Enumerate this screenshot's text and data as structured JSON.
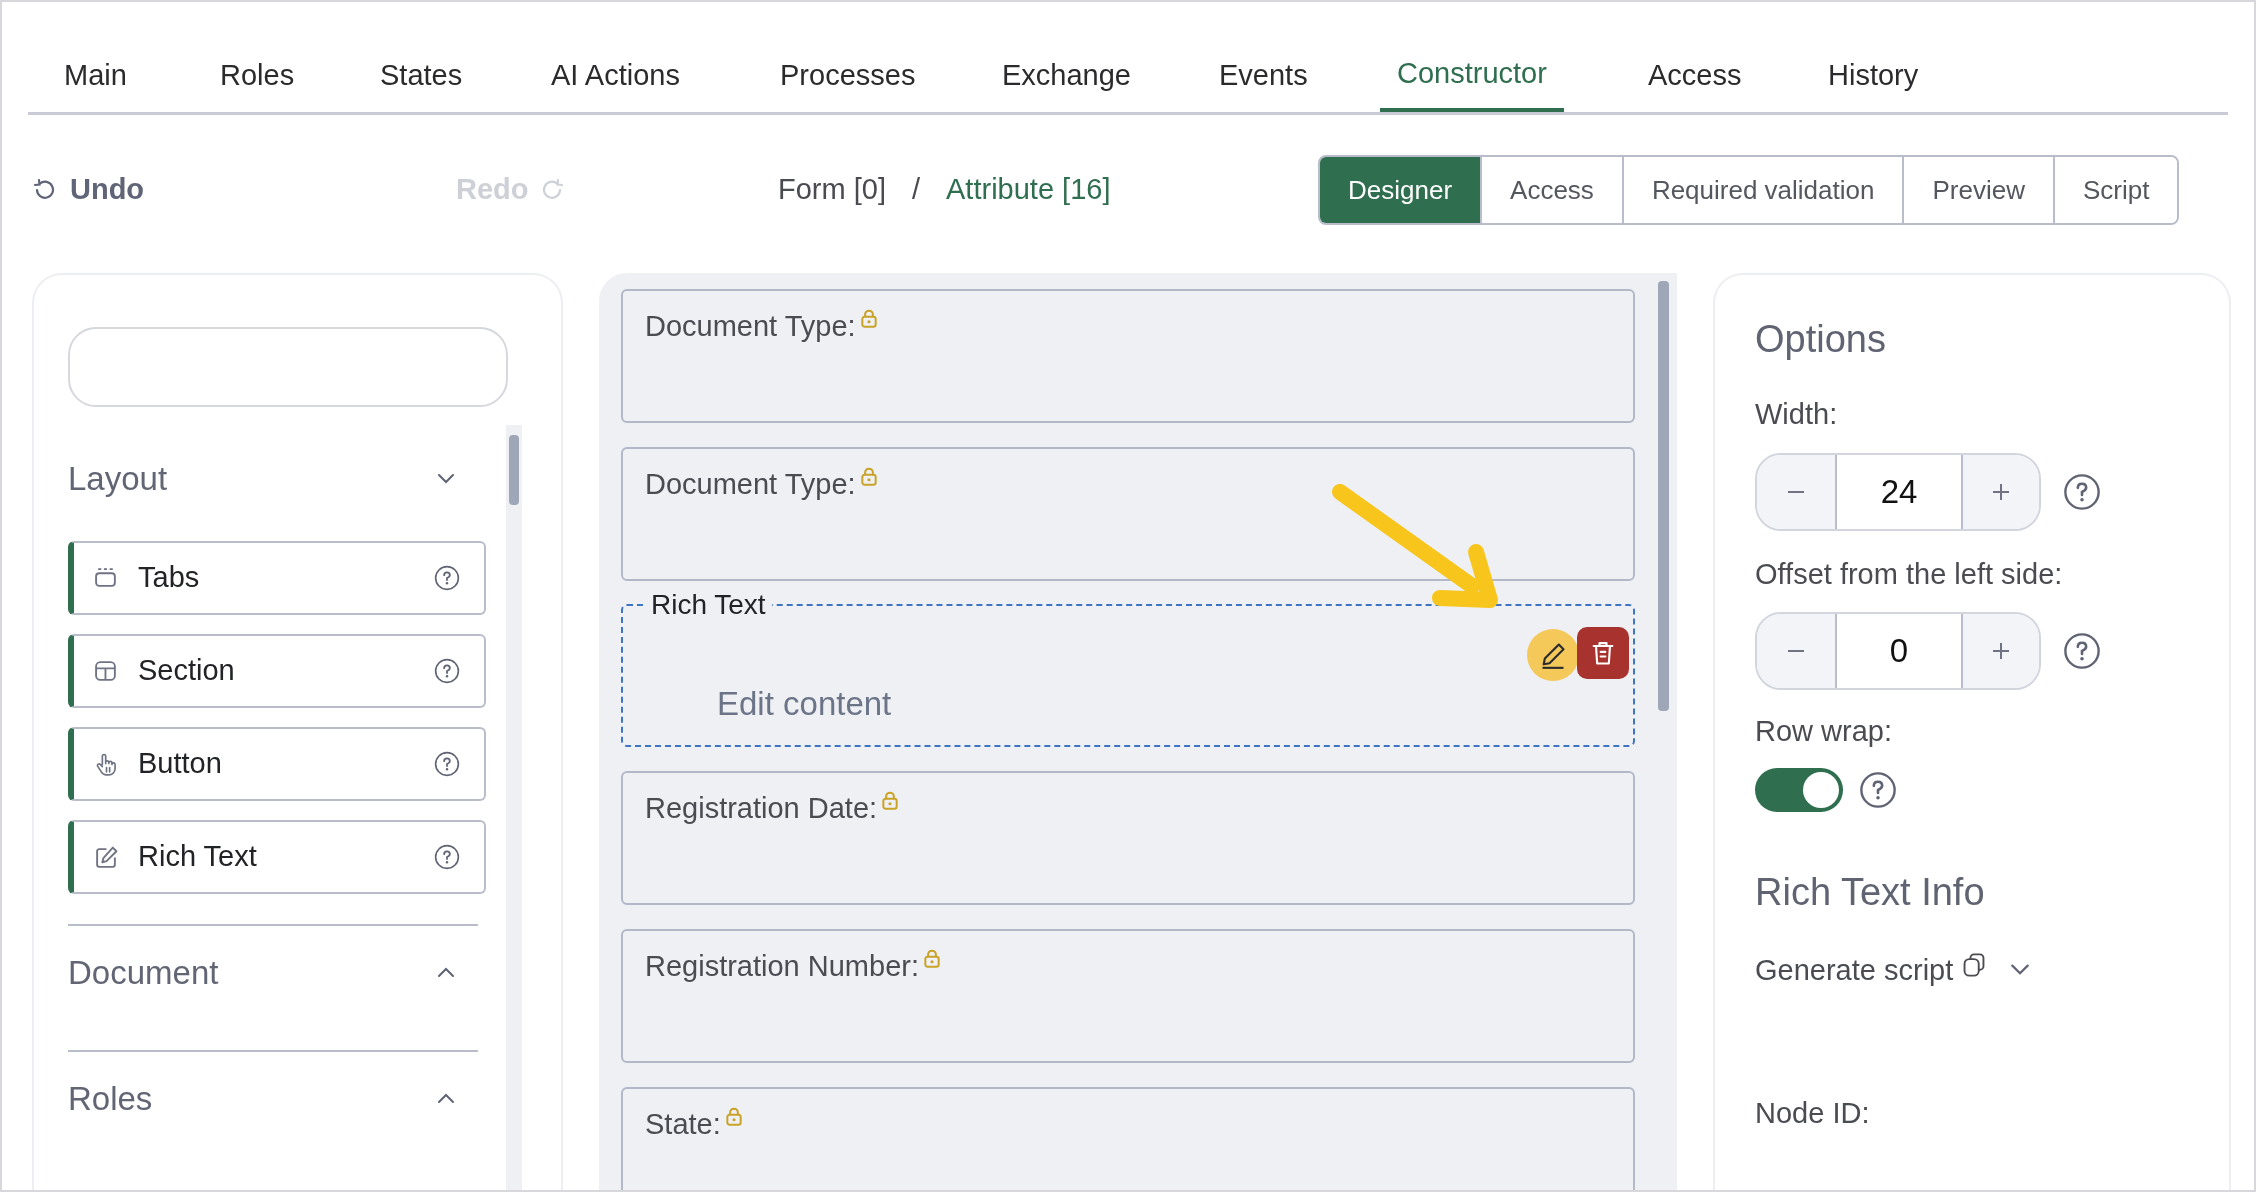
{
  "tabs": [
    {
      "label": "Main",
      "selected": false
    },
    {
      "label": "Roles",
      "selected": false
    },
    {
      "label": "States",
      "selected": false
    },
    {
      "label": "AI Actions",
      "selected": false
    },
    {
      "label": "Processes",
      "selected": false
    },
    {
      "label": "Exchange",
      "selected": false
    },
    {
      "label": "Events",
      "selected": false
    },
    {
      "label": "Constructor",
      "selected": true
    },
    {
      "label": "Access",
      "selected": false
    },
    {
      "label": "History",
      "selected": false
    }
  ],
  "toolbar": {
    "undo": {
      "label": "Undo",
      "disabled": false
    },
    "redo": {
      "label": "Redo",
      "disabled": true
    },
    "breadcrumb": [
      {
        "label": "Form [0]",
        "current": false
      },
      {
        "label": "Attribute [16]",
        "current": true
      }
    ],
    "separator": "/",
    "modes": [
      {
        "label": "Designer",
        "selected": true
      },
      {
        "label": "Access",
        "selected": false
      },
      {
        "label": "Required validation",
        "selected": false
      },
      {
        "label": "Preview",
        "selected": false
      },
      {
        "label": "Script",
        "selected": false
      }
    ]
  },
  "palette": {
    "sections": [
      {
        "title": "Layout",
        "expanded": true,
        "items": [
          {
            "label": "Tabs",
            "kind": "tabs"
          },
          {
            "label": "Section",
            "kind": "section"
          },
          {
            "label": "Button",
            "kind": "button"
          },
          {
            "label": "Rich Text",
            "kind": "rich_text"
          }
        ]
      },
      {
        "title": "Document",
        "expanded": false
      },
      {
        "title": "Roles",
        "expanded": false
      }
    ]
  },
  "canvas": {
    "fields": [
      {
        "kind": "field",
        "label": "Document Type:",
        "locked": true
      },
      {
        "kind": "field",
        "label": "Document Type:",
        "locked": true
      },
      {
        "kind": "rich_text",
        "label": "Rich Text",
        "content": "Edit content"
      },
      {
        "kind": "field",
        "label": "Registration Date:",
        "locked": true
      },
      {
        "kind": "field",
        "label": "Registration Number:",
        "locked": true
      },
      {
        "kind": "field",
        "label": "State:",
        "locked": true
      }
    ]
  },
  "options": {
    "title": "Options",
    "width": {
      "label": "Width:",
      "value": "24"
    },
    "offset": {
      "label": "Offset from the left side:",
      "value": "0"
    },
    "row_wrap": {
      "label": "Row wrap:",
      "on": true
    }
  },
  "info": {
    "title": "Rich Text Info",
    "generate_script": "Generate script",
    "node_id": "Node ID:"
  }
}
